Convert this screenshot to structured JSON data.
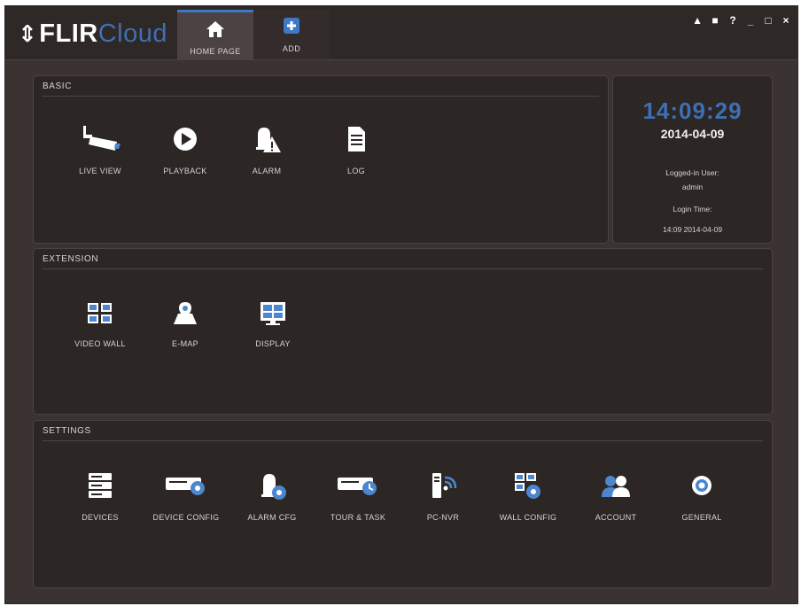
{
  "app": {
    "logo_mark": "⇕",
    "logo_flir": "FLIR",
    "logo_cloud": "Cloud",
    "tabs": [
      {
        "label": "HOME PAGE",
        "icon": "home-icon",
        "active": true
      },
      {
        "label": "ADD",
        "icon": "add-icon",
        "active": false
      }
    ],
    "window_controls": [
      "user-icon",
      "lock-icon",
      "help-icon",
      "minimize-icon",
      "maximize-icon",
      "close-icon"
    ],
    "window_glyphs": [
      "▲",
      "■",
      "?",
      "_",
      "□",
      "×"
    ]
  },
  "basic": {
    "title": "BASIC",
    "items": [
      {
        "label": "LIVE VIEW",
        "icon": "camera-icon"
      },
      {
        "label": "PLAYBACK",
        "icon": "play-icon"
      },
      {
        "label": "ALARM",
        "icon": "alarm-icon"
      },
      {
        "label": "LOG",
        "icon": "log-icon"
      }
    ]
  },
  "status": {
    "time": "14:09:29",
    "date": "2014-04-09",
    "logged_in_label": "Logged-in User:",
    "user": "admin",
    "login_time_label": "Login Time:",
    "login_time": "14:09 2014-04-09"
  },
  "extension": {
    "title": "EXTENSION",
    "items": [
      {
        "label": "VIDEO WALL",
        "icon": "video-wall-icon"
      },
      {
        "label": "E-MAP",
        "icon": "emap-icon"
      },
      {
        "label": "DISPLAY",
        "icon": "display-icon"
      }
    ]
  },
  "settings": {
    "title": "SETTINGS",
    "items": [
      {
        "label": "DEVICES",
        "icon": "devices-icon"
      },
      {
        "label": "DEVICE CONFIG",
        "icon": "device-config-icon"
      },
      {
        "label": "ALARM CFG",
        "icon": "alarm-cfg-icon"
      },
      {
        "label": "TOUR & TASK",
        "icon": "tour-task-icon"
      },
      {
        "label": "PC-NVR",
        "icon": "pc-nvr-icon"
      },
      {
        "label": "WALL CONFIG",
        "icon": "wall-config-icon"
      },
      {
        "label": "ACCOUNT",
        "icon": "account-icon"
      },
      {
        "label": "GENERAL",
        "icon": "general-icon"
      }
    ]
  },
  "colors": {
    "accent": "#3f6fb3",
    "background": "#3a3331",
    "panel": "#2c2624",
    "icon": "#ffffff"
  }
}
